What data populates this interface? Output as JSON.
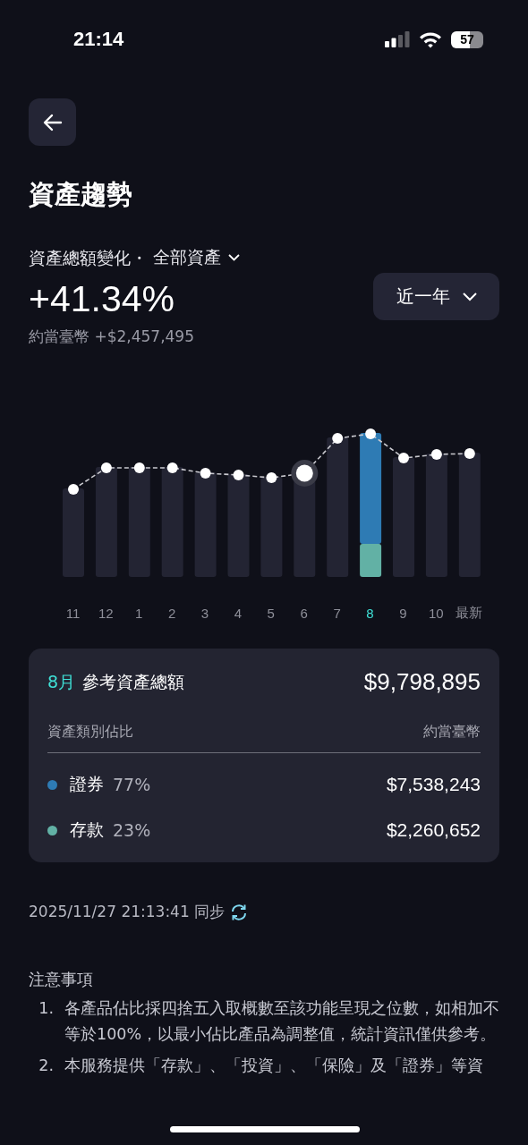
{
  "status_bar": {
    "time": "21:14",
    "battery": "57"
  },
  "title": "資產趨勢",
  "summary": {
    "metric": "資產總額變化・",
    "scope": "全部資產",
    "change": "+41.34%",
    "amount": "約當臺幣 +$2,457,495",
    "period": "近一年"
  },
  "months": [
    {
      "label": "11",
      "selected": false
    },
    {
      "label": "12",
      "selected": false
    },
    {
      "label": "1",
      "selected": false
    },
    {
      "label": "2",
      "selected": false
    },
    {
      "label": "3",
      "selected": false
    },
    {
      "label": "4",
      "selected": false
    },
    {
      "label": "5",
      "selected": false
    },
    {
      "label": "6",
      "selected": false
    },
    {
      "label": "7",
      "selected": false
    },
    {
      "label": "8",
      "selected": true
    },
    {
      "label": "9",
      "selected": false
    },
    {
      "label": "10",
      "selected": false
    },
    {
      "label": "最新",
      "selected": false
    }
  ],
  "card": {
    "month": "8月",
    "label": "參考資產總額",
    "total": "$9,798,895",
    "col_left": "資產類別佔比",
    "col_right": "約當臺幣",
    "rows": [
      {
        "name": "證券",
        "share": "77%",
        "value": "$7,538,243",
        "color": "#2e7bb4"
      },
      {
        "name": "存款",
        "share": "23%",
        "value": "$2,260,652",
        "color": "#62b1a5"
      }
    ]
  },
  "sync": "2025/11/27 21:13:41 同步",
  "notes": {
    "title": "注意事項",
    "items": [
      {
        "number": "1.",
        "text": "各產品佔比採四捨五入取概數至該功能呈現之位數，如相加不等於100%，以最小佔比產品為調整值，統計資訊僅供參考。"
      },
      {
        "number": "2.",
        "text": "本服務提供「存款」、「投資」、「保險」及「證券」等資"
      }
    ]
  }
}
